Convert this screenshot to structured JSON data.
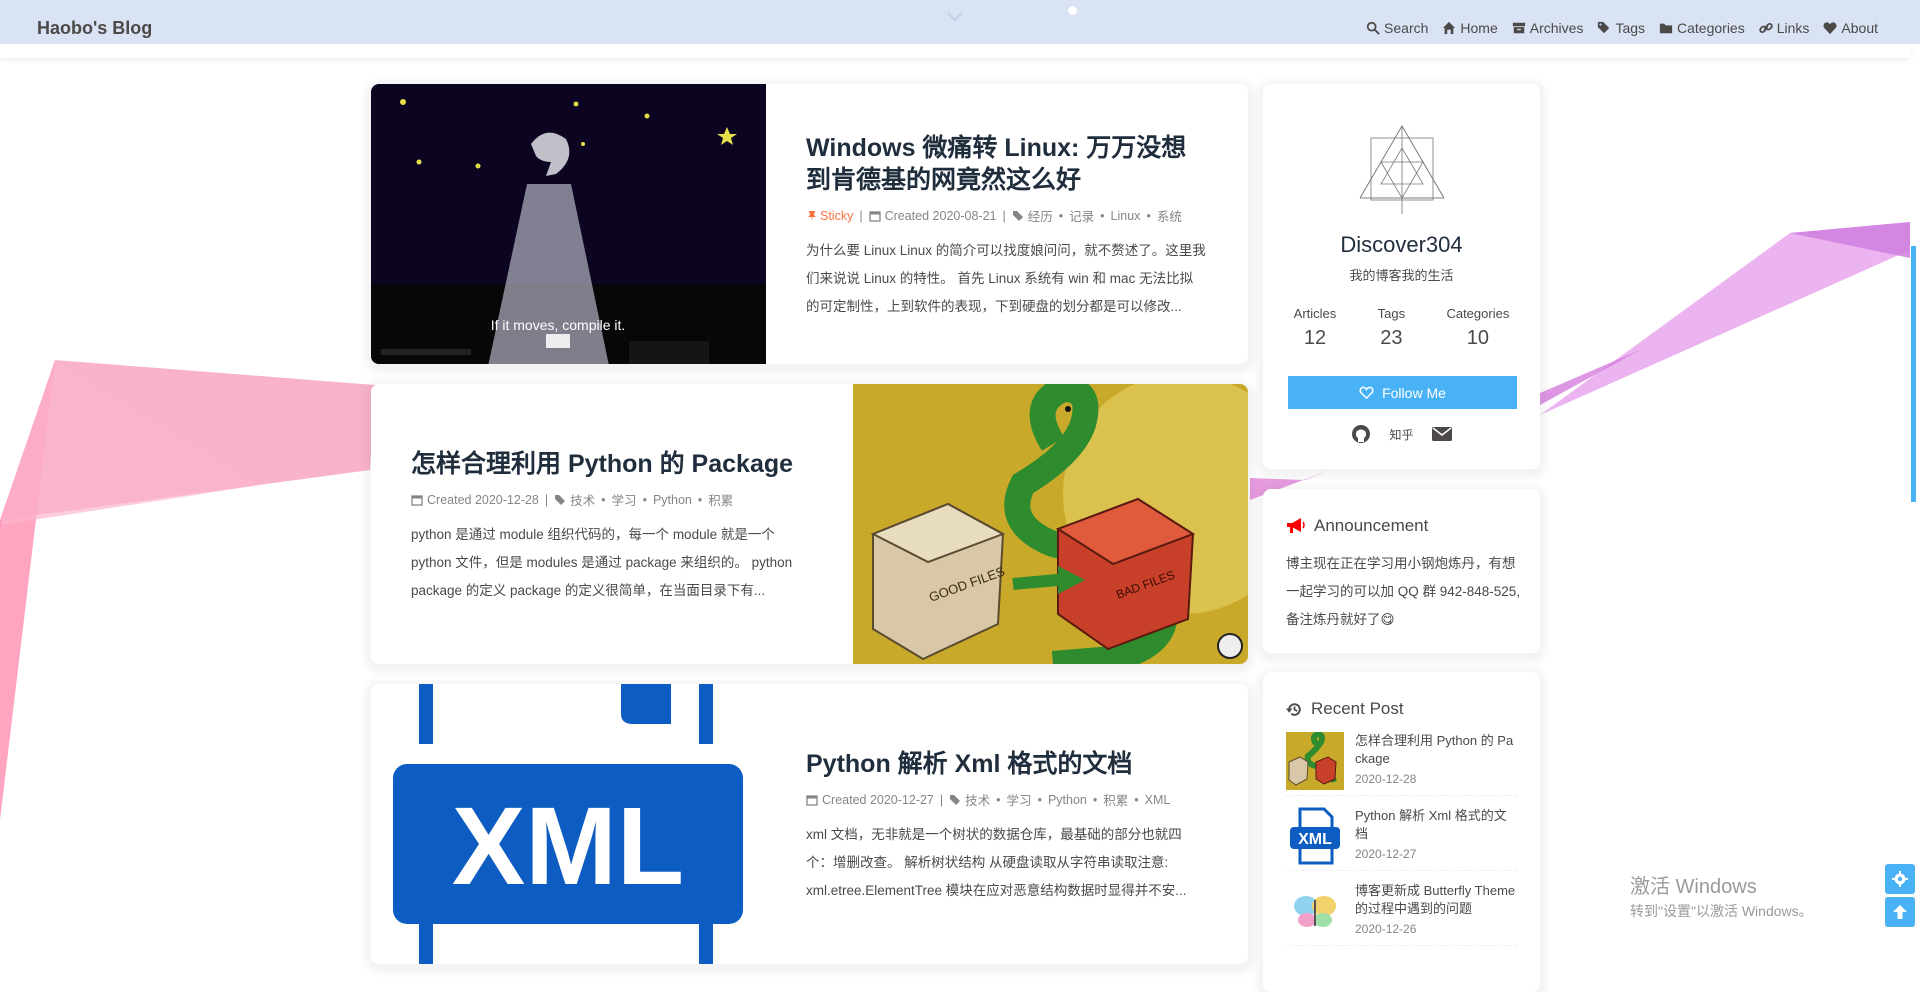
{
  "brand": "Haobo's Blog",
  "menu": [
    {
      "label": "Search",
      "icon": "search-icon"
    },
    {
      "label": "Home",
      "icon": "home-icon"
    },
    {
      "label": "Archives",
      "icon": "archive-icon"
    },
    {
      "label": "Tags",
      "icon": "tags-icon"
    },
    {
      "label": "Categories",
      "icon": "folder-icon"
    },
    {
      "label": "Links",
      "icon": "link-icon"
    },
    {
      "label": "About",
      "icon": "heart-icon"
    }
  ],
  "posts": [
    {
      "title": "Windows 微痛转 Linux: 万万没想到肯德基的网竟然这么好",
      "sticky": "Sticky",
      "created": "Created 2020-08-21",
      "tags": [
        "经历",
        "记录",
        "Linux",
        "系统"
      ],
      "excerpt": "为什么要 Linux Linux 的简介可以找度娘问问，就不赘述了。这里我们来说说 Linux 的特性。 首先 Linux 系统有 win 和 mac 无法比拟的可定制性，上到软件的表现，下到硬盘的划分都是可以修改...",
      "cover_caption": "If it moves, compile it."
    },
    {
      "title": "怎样合理利用 Python 的 Package",
      "created": "Created 2020-12-28",
      "tags": [
        "技术",
        "学习",
        "Python",
        "积累"
      ],
      "excerpt": "python 是通过 module 组织代码的，每一个 module 就是一个 python 文件，但是 modules 是通过 package 来组织的。 python package 的定义 package 的定义很简单，在当面目录下有...",
      "cover_box_text": "GOOD FILES",
      "cover_box2_text": "BAD FILES"
    },
    {
      "title": "Python 解析 Xml 格式的文档",
      "created": "Created 2020-12-27",
      "tags": [
        "技术",
        "学习",
        "Python",
        "积累",
        "XML"
      ],
      "excerpt": "xml 文档，无非就是一个树状的数据仓库，最基础的部分也就四个：增删改查。 解析树状结构 从硬盘读取从字符串读取注意: xml.etree.ElementTree 模块在应对恶意结构数据时显得并不安...",
      "cover_text": "XML"
    }
  ],
  "author": {
    "name": "Discover304",
    "desc": "我的博客我的生活",
    "stats": [
      {
        "label": "Articles",
        "value": "12"
      },
      {
        "label": "Tags",
        "value": "23"
      },
      {
        "label": "Categories",
        "value": "10"
      }
    ],
    "follow": "Follow Me",
    "zhihu": "知乎"
  },
  "announcement": {
    "title": "Announcement",
    "text": "博主现在正在学习用小钢炮炼丹，有想一起学习的可以加 QQ 群 942-848-525, 备注炼丹就好了😋"
  },
  "recent": {
    "title": "Recent Post",
    "items": [
      {
        "title": "怎样合理利用 Python 的 Package",
        "date": "2020-12-28"
      },
      {
        "title": "Python 解析 Xml 格式的文档",
        "date": "2020-12-27"
      },
      {
        "title": "博客更新成 Butterfly Theme 的过程中遇到的问题",
        "date": "2020-12-26"
      }
    ]
  },
  "watermark": {
    "title": "激活 Windows",
    "sub": "转到\"设置\"以激活 Windows。"
  },
  "colors": {
    "accent": "#49b1f5",
    "sticky": "#ff7242",
    "navbar": "#d9e3f4"
  }
}
